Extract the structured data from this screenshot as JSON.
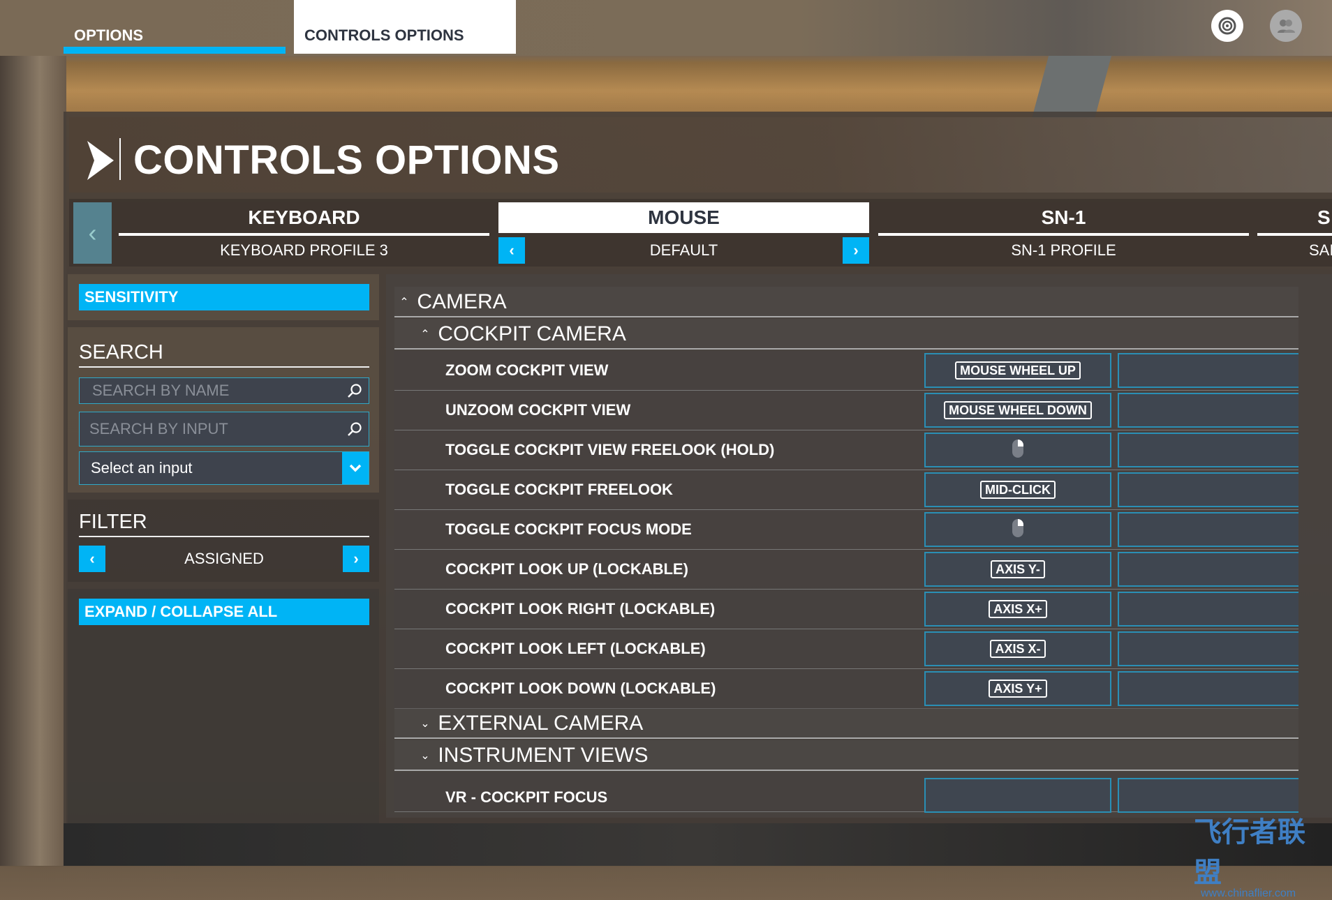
{
  "topbar": {
    "tabs": [
      {
        "label": "OPTIONS",
        "active": true
      },
      {
        "label": "CONTROLS OPTIONS",
        "selected": true
      }
    ],
    "icons": [
      "activity-icon",
      "friends-icon"
    ]
  },
  "header": {
    "title": "CONTROLS OPTIONS"
  },
  "profiles": [
    {
      "device": "KEYBOARD",
      "profile": "KEYBOARD PROFILE 3"
    },
    {
      "device": "MOUSE",
      "profile": "DEFAULT",
      "active": true
    },
    {
      "device": "SN-1",
      "profile": "SN-1 PROFILE"
    },
    {
      "device": "S",
      "profile": "SAI"
    }
  ],
  "sidebar": {
    "sensitivity": "SENSITIVITY",
    "search_title": "SEARCH",
    "search_name_placeholder": "SEARCH BY NAME",
    "search_input_placeholder": "SEARCH BY INPUT",
    "select_input": "Select an input",
    "filter_title": "FILTER",
    "filter_value": "ASSIGNED",
    "expand_collapse": "EXPAND / COLLAPSE ALL"
  },
  "bindings": {
    "camera": "CAMERA",
    "cockpit_camera": "COCKPIT CAMERA",
    "rows": [
      {
        "label": "ZOOM COCKPIT VIEW",
        "input1": "MOUSE WHEEL UP"
      },
      {
        "label": "UNZOOM COCKPIT VIEW",
        "input1": "MOUSE WHEEL DOWN"
      },
      {
        "label": "TOGGLE COCKPIT VIEW FREELOOK (HOLD)",
        "input1_icon": "mouse-right-button-icon"
      },
      {
        "label": "TOGGLE COCKPIT FREELOOK",
        "input1": "MID-CLICK"
      },
      {
        "label": "TOGGLE COCKPIT FOCUS MODE",
        "input1_icon": "mouse-right-button-icon"
      },
      {
        "label": "COCKPIT LOOK UP (LOCKABLE)",
        "input1": "AXIS Y-"
      },
      {
        "label": "COCKPIT LOOK RIGHT (LOCKABLE)",
        "input1": "AXIS X+"
      },
      {
        "label": "COCKPIT LOOK LEFT (LOCKABLE)",
        "input1": "AXIS X-"
      },
      {
        "label": "COCKPIT LOOK DOWN (LOCKABLE)",
        "input1": "AXIS Y+"
      }
    ],
    "external_camera": "EXTERNAL CAMERA",
    "instrument_views": "INSTRUMENT VIEWS",
    "partial_row": "VR - COCKPIT FOCUS"
  },
  "watermark": {
    "text": "飞行者联盟",
    "url": "www.chinaflier.com"
  },
  "colors": {
    "accent": "#00b4f5",
    "binding_bg": "#3f4650"
  }
}
